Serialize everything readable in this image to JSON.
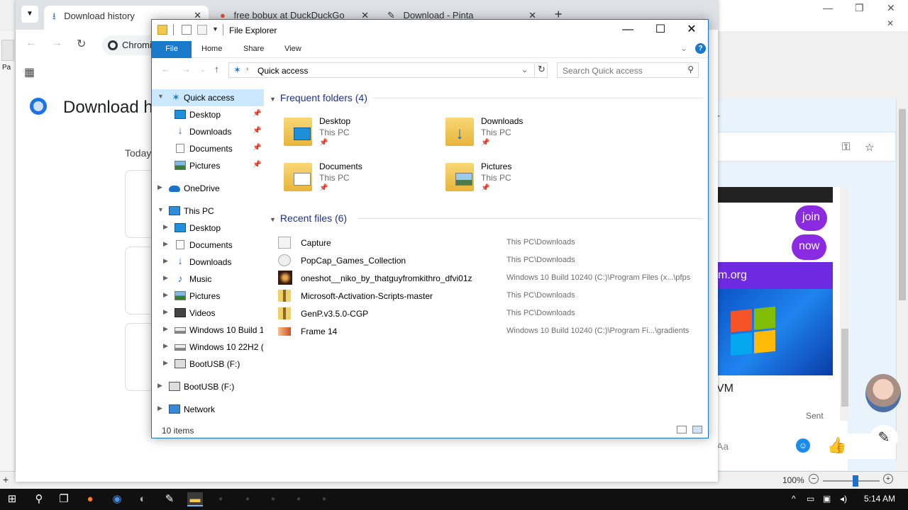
{
  "pinta": {
    "zoom": "100%",
    "zoom_minus": "−",
    "zoom_plus": "+",
    "left_label": "Pa",
    "status_crosshair": "+"
  },
  "chrome": {
    "tabs": [
      {
        "label": "Download history",
        "icon": "download-icon"
      },
      {
        "label": "free bobux at DuckDuckGo",
        "icon": "duckduckgo-icon"
      },
      {
        "label": "Download - Pinta",
        "icon": "pinta-icon"
      }
    ],
    "new_tab": "+",
    "omnibox_text": "Chromi",
    "page_title": "Download h",
    "today_label": "Today"
  },
  "chat": {
    "bubbles": [
      "join",
      "now"
    ],
    "banner_text": "m.org",
    "vm_text": "VM",
    "sent_label": "Sent",
    "input_placeholder": "Aa"
  },
  "explorer": {
    "title": "File Explorer",
    "ribbon_tabs": [
      "File",
      "Home",
      "Share",
      "View"
    ],
    "help": "?",
    "address": "Quick access",
    "search_placeholder": "Search Quick access",
    "nav": [
      {
        "label": "Quick access",
        "icon": "star-icon",
        "level": 0,
        "arrow": "expanded",
        "selected": true
      },
      {
        "label": "Desktop",
        "icon": "desktop-icon",
        "level": 1,
        "arrow": "none",
        "pinned": true
      },
      {
        "label": "Downloads",
        "icon": "downloads-icon",
        "level": 1,
        "arrow": "none",
        "pinned": true
      },
      {
        "label": "Documents",
        "icon": "documents-icon",
        "level": 1,
        "arrow": "none",
        "pinned": true
      },
      {
        "label": "Pictures",
        "icon": "pictures-icon",
        "level": 1,
        "arrow": "none",
        "pinned": true
      },
      {
        "label": "OneDrive",
        "icon": "onedrive-icon",
        "level": 0,
        "arrow": "collapsed"
      },
      {
        "label": "This PC",
        "icon": "pc-icon",
        "level": 0,
        "arrow": "expanded"
      },
      {
        "label": "Desktop",
        "icon": "desktop-icon",
        "level": 1,
        "arrow": "collapsed"
      },
      {
        "label": "Documents",
        "icon": "documents-icon",
        "level": 1,
        "arrow": "collapsed"
      },
      {
        "label": "Downloads",
        "icon": "downloads-icon",
        "level": 1,
        "arrow": "collapsed"
      },
      {
        "label": "Music",
        "icon": "music-icon",
        "level": 1,
        "arrow": "collapsed"
      },
      {
        "label": "Pictures",
        "icon": "pictures-icon",
        "level": 1,
        "arrow": "collapsed"
      },
      {
        "label": "Videos",
        "icon": "videos-icon",
        "level": 1,
        "arrow": "collapsed"
      },
      {
        "label": "Windows 10 Build 1",
        "icon": "drive-icon",
        "level": 1,
        "arrow": "collapsed"
      },
      {
        "label": "Windows 10 22H2 (I",
        "icon": "drive-icon",
        "level": 1,
        "arrow": "collapsed"
      },
      {
        "label": "BootUSB (F:)",
        "icon": "usb-icon",
        "level": 1,
        "arrow": "collapsed"
      },
      {
        "label": "BootUSB (F:)",
        "icon": "usb-icon",
        "level": 0,
        "arrow": "collapsed"
      },
      {
        "label": "Network",
        "icon": "network-icon",
        "level": 0,
        "arrow": "collapsed"
      }
    ],
    "frequent_header": "Frequent folders (4)",
    "frequent": [
      {
        "name": "Desktop",
        "sub": "This PC",
        "icon": "desktop-folder-icon"
      },
      {
        "name": "Downloads",
        "sub": "This PC",
        "icon": "downloads-folder-icon"
      },
      {
        "name": "Documents",
        "sub": "This PC",
        "icon": "documents-folder-icon"
      },
      {
        "name": "Pictures",
        "sub": "This PC",
        "icon": "pictures-folder-icon"
      }
    ],
    "recent_header": "Recent files (6)",
    "recent": [
      {
        "name": "Capture",
        "path": "This PC\\Downloads",
        "icon": "image-file-icon"
      },
      {
        "name": "PopCap_Games_Collection",
        "path": "This PC\\Downloads",
        "icon": "disc-image-icon"
      },
      {
        "name": "oneshot__niko_by_thatguyfromkithro_dfvi01z",
        "path": "Windows 10 Build 10240 (C:)\\Program Files (x...\\pfps",
        "icon": "photo-file-icon"
      },
      {
        "name": "Microsoft-Activation-Scripts-master",
        "path": "This PC\\Downloads",
        "icon": "zip-folder-icon"
      },
      {
        "name": "GenP.v3.5.0-CGP",
        "path": "This PC\\Downloads",
        "icon": "zip-folder-icon"
      },
      {
        "name": "Frame 14",
        "path": "Windows 10 Build 10240 (C:)\\Program Fi...\\gradients",
        "icon": "gradient-file-icon"
      }
    ],
    "status": "10 items"
  },
  "taskbar": {
    "time": "5:14 AM"
  }
}
